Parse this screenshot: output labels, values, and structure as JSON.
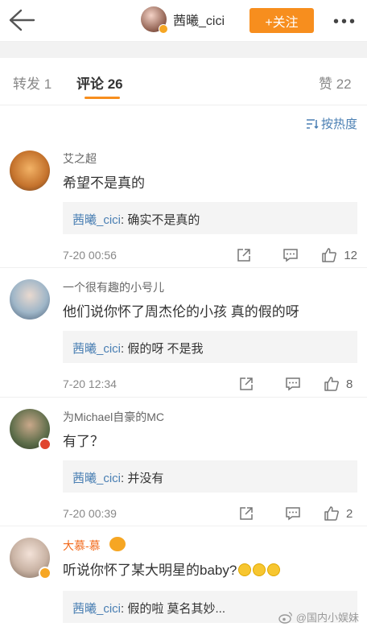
{
  "header": {
    "username": "茜曦_cici",
    "follow_label": "+关注",
    "more_label": "•••"
  },
  "tabs": {
    "repost": "转发 1",
    "comment": "评论 26",
    "like": "赞 22"
  },
  "sort_label": "按热度",
  "comments": [
    {
      "name": "艾之超",
      "text": "希望不是真的",
      "reply_name": "茜曦_cici",
      "reply_text": ": 确实不是真的",
      "time": "7-20 00:56",
      "likes": "12"
    },
    {
      "name": "一个很有趣的小号儿",
      "text": "他们说你怀了周杰伦的小孩 真的假的呀",
      "reply_name": "茜曦_cici",
      "reply_text": ": 假的呀 不是我",
      "time": "7-20 12:34",
      "likes": "8"
    },
    {
      "name": "为Michael自豪的MC",
      "text": "有了？",
      "reply_name": "茜曦_cici",
      "reply_text": ": 并没有",
      "time": "7-20 00:39",
      "likes": "2"
    },
    {
      "name": "大慕-慕",
      "text": "听说你怀了某大明星的baby?",
      "reply_name": "茜曦_cici",
      "reply_text": ": 假的啦 莫名其妙...",
      "time": "",
      "likes": ""
    }
  ],
  "watermark": "@国内小娱妹",
  "colors": {
    "accent": "#f78e1e",
    "link": "#4a7fb3",
    "vip_name": "#f26a1b"
  }
}
